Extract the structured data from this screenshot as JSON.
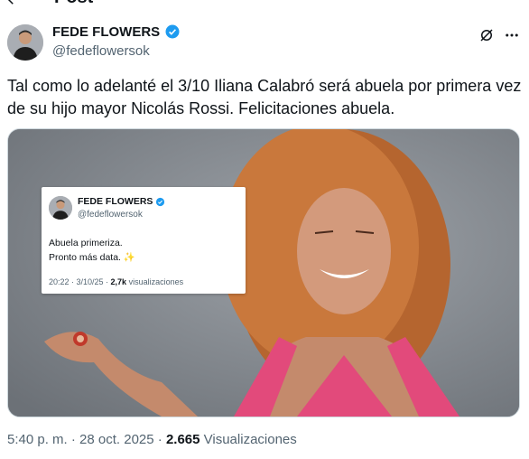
{
  "header": {
    "title": "Post",
    "back_icon": "arrow-left-icon"
  },
  "author": {
    "name": "FEDE FLOWERS",
    "handle": "@fedeflowersok",
    "verified_color": "#1d9bf0"
  },
  "tweet": {
    "text": "Tal como lo adelanté el 3/10 Iliana Calabró será abuela por primera vez de su hijo mayor Nicolás Rossi. Felicitaciones abuela."
  },
  "quoted": {
    "name": "FEDE FLOWERS",
    "handle": "@fedeflowersok",
    "line1": "Abuela primeriza.",
    "line2": "Pronto más data.",
    "sparkle": "✨",
    "time": "20:22 · 3/10/25 · ",
    "views_count": "2,7k",
    "views_label": " visualizaciones"
  },
  "footer": {
    "timestamp": "5:40 p. m. · 28 oct. 2025 · ",
    "views_count": "2.665",
    "views_label": " Visualizaciones"
  },
  "icons": {
    "grok": "grok-slash-icon",
    "more": "more-horizontal-icon"
  }
}
